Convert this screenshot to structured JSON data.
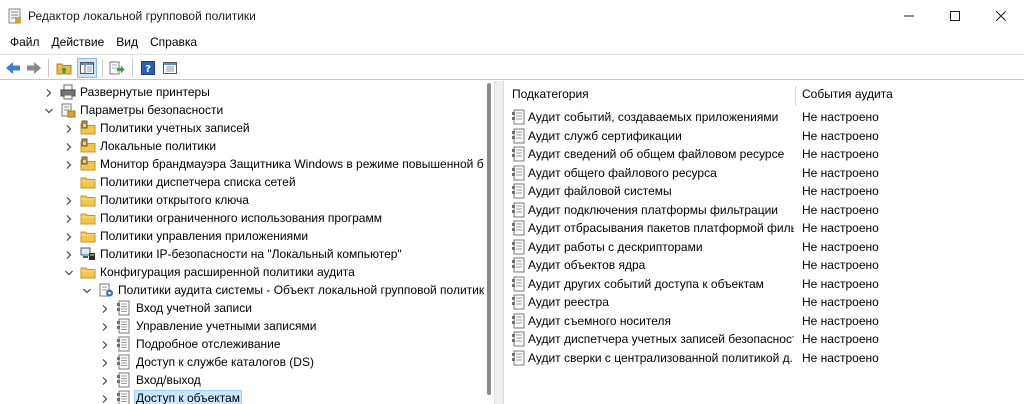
{
  "window": {
    "title": "Редактор локальной групповой политики",
    "icon": "gpedit-icon"
  },
  "menu": [
    "Файл",
    "Действие",
    "Вид",
    "Справка"
  ],
  "toolbar": [
    "back-arrow-icon",
    "forward-arrow-icon",
    "up-folder-icon",
    "show-hide-tree-icon",
    "export-list-icon",
    "help-icon",
    "properties-icon"
  ],
  "tree": [
    {
      "label": "Развернутые принтеры",
      "icon": "printer-icon",
      "expanded": false
    },
    {
      "label": "Параметры безопасности",
      "icon": "security-settings-icon",
      "expanded": true
    },
    {
      "label": "Политики учетных записей",
      "icon": "locked-folder-icon",
      "expanded": false
    },
    {
      "label": "Локальные политики",
      "icon": "locked-folder-icon",
      "expanded": false
    },
    {
      "label": "Монитор брандмауэра Защитника Windows в режиме повышенной бе",
      "icon": "locked-folder-icon",
      "expanded": false
    },
    {
      "label": "Политики диспетчера списка сетей",
      "icon": "folder-icon",
      "expanded": null
    },
    {
      "label": "Политики открытого ключа",
      "icon": "folder-icon",
      "expanded": false
    },
    {
      "label": "Политики ограниченного использования программ",
      "icon": "folder-icon",
      "expanded": false
    },
    {
      "label": "Политики управления приложениями",
      "icon": "folder-icon",
      "expanded": false
    },
    {
      "label": "Политики IP-безопасности на \"Локальный компьютер\"",
      "icon": "network-policy-icon",
      "expanded": false
    },
    {
      "label": "Конфигурация расширенной политики аудита",
      "icon": "folder-icon",
      "expanded": true
    },
    {
      "label": "Политики аудита системы - Объект локальной групповой политики",
      "icon": "audit-policy-icon",
      "expanded": true
    },
    {
      "label": "Вход учетной записи",
      "icon": "audit-category-icon",
      "expanded": false
    },
    {
      "label": "Управление учетными записями",
      "icon": "audit-category-icon",
      "expanded": false
    },
    {
      "label": "Подробное отслеживание",
      "icon": "audit-category-icon",
      "expanded": false
    },
    {
      "label": "Доступ к службе каталогов (DS)",
      "icon": "audit-category-icon",
      "expanded": false
    },
    {
      "label": "Вход/выход",
      "icon": "audit-category-icon",
      "expanded": false
    },
    {
      "label": "Доступ к объектам",
      "icon": "audit-category-icon",
      "expanded": false,
      "selected": true
    }
  ],
  "list": {
    "columns": [
      "Подкатегория",
      "События аудита"
    ],
    "rows": [
      {
        "name": "Аудит событий, создаваемых приложениями",
        "value": "Не настроено"
      },
      {
        "name": "Аудит служб сертификации",
        "value": "Не настроено"
      },
      {
        "name": "Аудит сведений об общем файловом ресурсе",
        "value": "Не настроено"
      },
      {
        "name": "Аудит общего файлового ресурса",
        "value": "Не настроено"
      },
      {
        "name": "Аудит файловой системы",
        "value": "Не настроено"
      },
      {
        "name": "Аудит подключения платформы фильтрации",
        "value": "Не настроено"
      },
      {
        "name": "Аудит отбрасывания пакетов платформой филь...",
        "value": "Не настроено"
      },
      {
        "name": "Аудит работы с дескрипторами",
        "value": "Не настроено"
      },
      {
        "name": "Аудит объектов ядра",
        "value": "Не настроено"
      },
      {
        "name": "Аудит других событий доступа к объектам",
        "value": "Не настроено"
      },
      {
        "name": "Аудит реестра",
        "value": "Не настроено"
      },
      {
        "name": "Аудит съемного носителя",
        "value": "Не настроено"
      },
      {
        "name": "Аудит диспетчера учетных записей безопасности",
        "value": "Не настроено"
      },
      {
        "name": "Аудит сверки с централизованной политикой д...",
        "value": "Не настроено"
      }
    ]
  },
  "colors": {
    "selection_bg": "#cce8ff",
    "selection_border": "#99d1ff",
    "toolbar_active": "#cfe4f7"
  }
}
